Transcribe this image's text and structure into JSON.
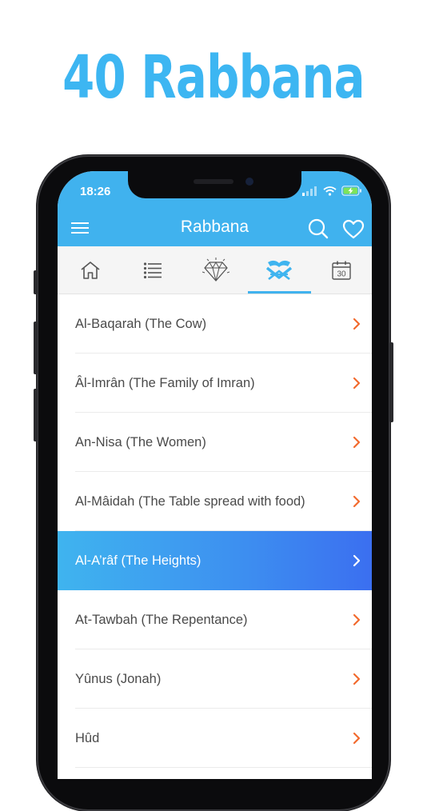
{
  "headline": "40 Rabbana",
  "status": {
    "time": "18:26"
  },
  "appbar": {
    "title": "Rabbana"
  },
  "tabs": [
    {
      "id": "home",
      "icon": "home-icon"
    },
    {
      "id": "list",
      "icon": "list-icon"
    },
    {
      "id": "diamond",
      "icon": "diamond-icon"
    },
    {
      "id": "quran",
      "icon": "quran-icon",
      "selected": true
    },
    {
      "id": "calendar",
      "icon": "calendar-icon",
      "day": "30"
    }
  ],
  "surahs": [
    {
      "label": "Al-Baqarah (The Cow)"
    },
    {
      "label": "Âl-Imrân (The Family of Imran)"
    },
    {
      "label": "An-Nisa (The Women)"
    },
    {
      "label": "Al-Mâidah (The Table spread with food)"
    },
    {
      "label": "Al-A’râf (The Heights)",
      "selected": true
    },
    {
      "label": "At-Tawbah (The Repentance)"
    },
    {
      "label": "Yûnus (Jonah)"
    },
    {
      "label": "Hûd"
    }
  ],
  "colors": {
    "brand": "#40b2ee",
    "headline": "#3db6f2",
    "chevron": "#f26a2e",
    "selected_gradient_end": "#3b6ff0"
  }
}
